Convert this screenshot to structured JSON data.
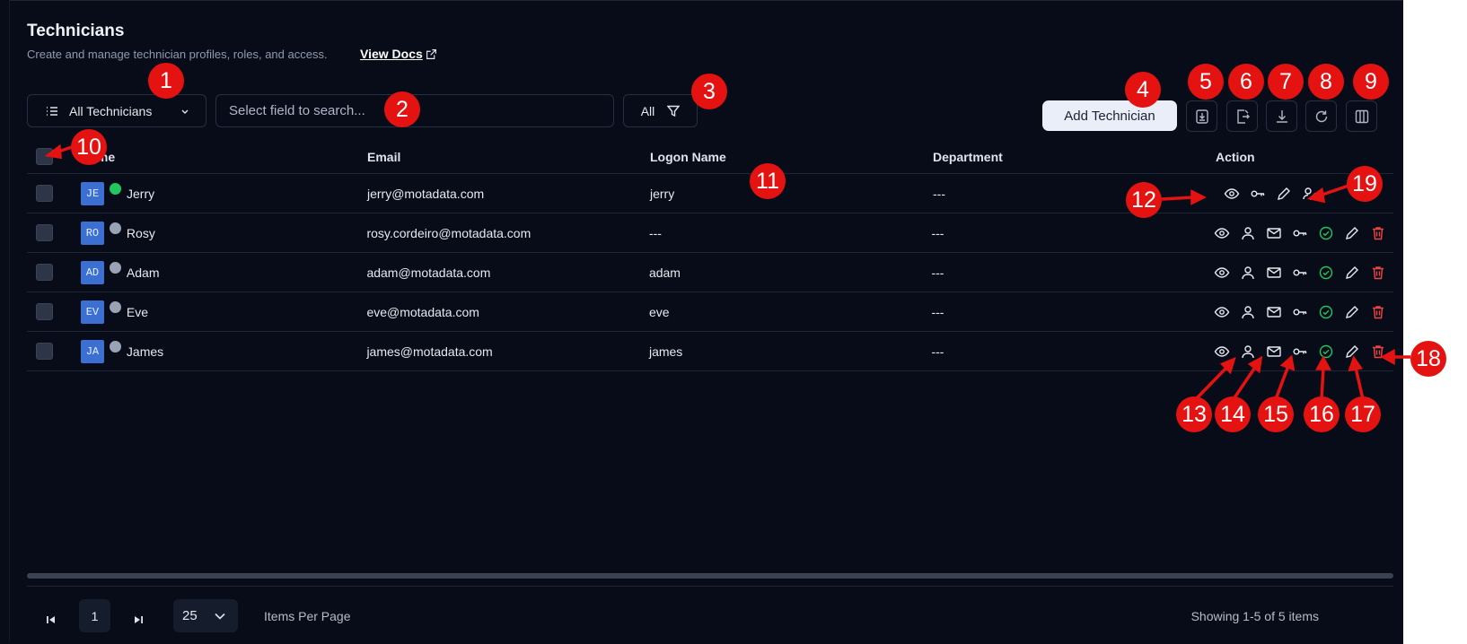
{
  "header": {
    "title": "Technicians",
    "subtitle": "Create and manage technician profiles, roles, and access.",
    "docs_link": "View Docs"
  },
  "toolbar": {
    "view_select": "All Technicians",
    "search_placeholder": "Select field to search...",
    "filter_label": "All",
    "add_button": "Add Technician",
    "tool_icons": [
      "import-icon",
      "export-icon",
      "download-icon",
      "refresh-icon",
      "columns-icon"
    ]
  },
  "table": {
    "columns": [
      "Name",
      "Email",
      "Logon Name",
      "Department",
      "Action"
    ],
    "rows": [
      {
        "initials": "JE",
        "name": "Jerry",
        "status_color": "#22c55e",
        "email": "jerry@motadata.com",
        "logon": "jerry",
        "department": "---"
      },
      {
        "initials": "RO",
        "name": "Rosy",
        "status_color": "#9aa3b5",
        "email": "rosy.cordeiro@motadata.com",
        "logon": "---",
        "department": "---"
      },
      {
        "initials": "AD",
        "name": "Adam",
        "status_color": "#9aa3b5",
        "email": "adam@motadata.com",
        "logon": "adam",
        "department": "---"
      },
      {
        "initials": "EV",
        "name": "Eve",
        "status_color": "#9aa3b5",
        "email": "eve@motadata.com",
        "logon": "eve",
        "department": "---"
      },
      {
        "initials": "JA",
        "name": "James",
        "status_color": "#9aa3b5",
        "email": "james@motadata.com",
        "logon": "james",
        "department": "---"
      }
    ]
  },
  "footer": {
    "page": "1",
    "per_page": "25",
    "per_page_label": "Items Per Page",
    "showing": "Showing 1-5 of 5 items"
  },
  "markers": [
    "1",
    "2",
    "3",
    "4",
    "5",
    "6",
    "7",
    "8",
    "9",
    "10",
    "11",
    "12",
    "13",
    "14",
    "15",
    "16",
    "17",
    "18",
    "19"
  ],
  "colors": {
    "accent_green": "#22c55e",
    "danger_red": "#ef4444",
    "marker_red": "#e51212"
  }
}
